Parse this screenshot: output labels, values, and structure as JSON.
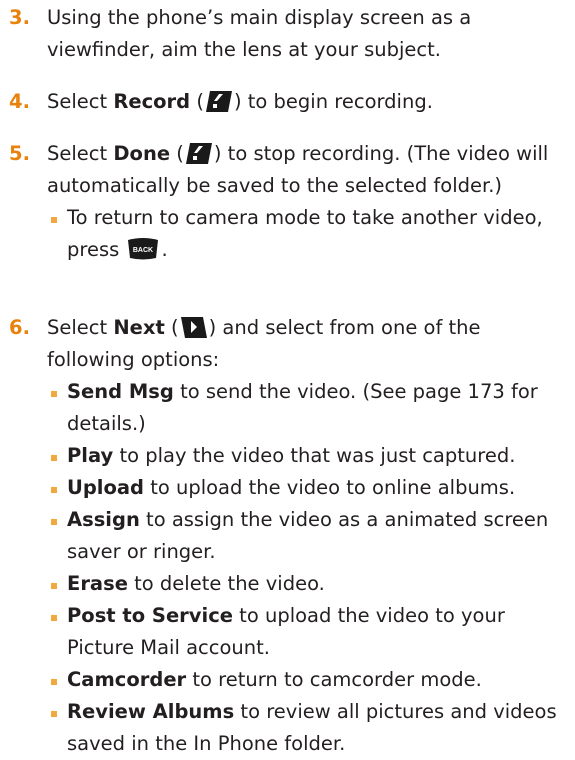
{
  "steps": {
    "s3": {
      "num": "3.",
      "text": "Using the phone’s main display screen as a viewfinder, aim the lens at your subject."
    },
    "s4": {
      "num": "4.",
      "pre": "Select ",
      "bold": "Record",
      "open": " (",
      "close": ") to begin recording."
    },
    "s5": {
      "num": "5.",
      "pre": "Select ",
      "bold": "Done",
      "open": " (",
      "close": ") to stop recording. (The video will automatically be saved to the selected folder.)",
      "bullet_pre": "To return to camera mode to take another video, press ",
      "bullet_post": "."
    },
    "s6": {
      "num": "6.",
      "pre": "Select ",
      "bold": "Next",
      "open": " (",
      "close": ") and select from one of the following options:"
    }
  },
  "options": [
    {
      "bold": "Send Msg",
      "text": " to send the video. (See page 173 for details.)"
    },
    {
      "bold": "Play",
      "text": " to play the video that was just captured."
    },
    {
      "bold": "Upload",
      "text": " to upload the video to online albums."
    },
    {
      "bold": "Assign",
      "text": " to assign the video as a animated screen saver or ringer."
    },
    {
      "bold": "Erase",
      "text": " to delete the video."
    },
    {
      "bold": "Post to Service",
      "text": " to upload the video to your Picture Mail account."
    },
    {
      "bold": "Camcorder",
      "text": " to return to camcorder mode."
    },
    {
      "bold": "Review Albums",
      "text": " to review all pictures and videos saved in the In Phone folder."
    }
  ],
  "icons": {
    "left_softkey": "left-softkey-icon",
    "right_softkey": "right-softkey-icon",
    "back_key": "back-key-icon",
    "back_key_label": "BACK"
  },
  "colors": {
    "step_number": "#e8820c",
    "bullet": "#f3a73f",
    "text": "#231f20"
  }
}
